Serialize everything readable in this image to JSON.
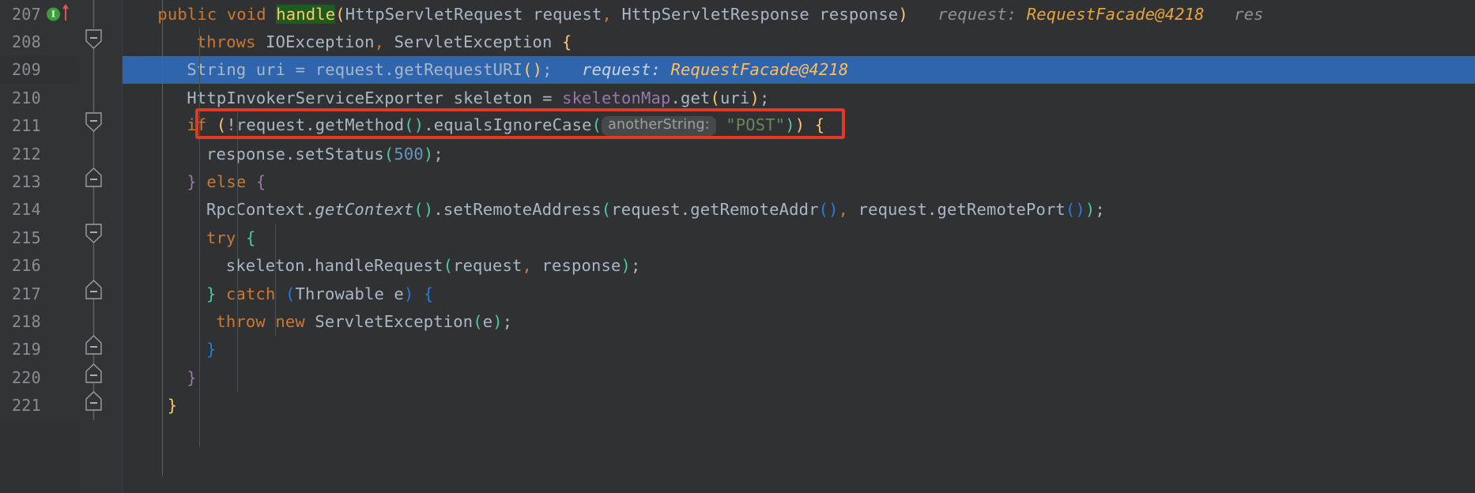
{
  "editor": {
    "language": "Java",
    "theme": "Darcula",
    "selected_line": 209,
    "annotation": {
      "type": "rectangle-highlight",
      "color": "#e03b22",
      "target_line": 211
    },
    "colors": {
      "background": "#2f3133",
      "gutter": "#313335",
      "selection": "#2f65ad",
      "keyword": "#cc7832",
      "string": "#6a8759",
      "number": "#6897bb",
      "identifier": "#a9b7c6",
      "static_field": "#9876aa",
      "method_paren": "#ffc66d",
      "inline_hint": "#8c9194",
      "hint_value": "#e8a33d",
      "annotation_red": "#e03b22",
      "usage_highlight": "#1d5c1d"
    },
    "gutter_icons": {
      "implementation_marker": {
        "line": 207,
        "glyph": "I",
        "color": "#3a9e3a",
        "arrow_color": "#e05b4b"
      }
    },
    "fold_markers": [
      {
        "line": 208,
        "direction": "start"
      },
      {
        "line": 211,
        "direction": "start"
      },
      {
        "line": 213,
        "direction": "end"
      },
      {
        "line": 215,
        "direction": "start"
      },
      {
        "line": 217,
        "direction": "end"
      },
      {
        "line": 219,
        "direction": "end"
      },
      {
        "line": 220,
        "direction": "end"
      },
      {
        "line": 221,
        "direction": "end"
      }
    ],
    "lines": [
      {
        "number": "207",
        "indent": 4,
        "tokens": [
          {
            "t": "public",
            "c": "kw"
          },
          {
            "t": " ",
            "c": "plain"
          },
          {
            "t": "void",
            "c": "kw"
          },
          {
            "t": " ",
            "c": "plain"
          },
          {
            "t": "handle",
            "c": "hl-green"
          },
          {
            "t": "(",
            "c": "paren"
          },
          {
            "t": "HttpServletRequest request",
            "c": "plain"
          },
          {
            "t": ",",
            "c": "comma"
          },
          {
            "t": " HttpServletResponse response",
            "c": "plain"
          },
          {
            "t": ")",
            "c": "paren"
          }
        ],
        "hints": [
          {
            "label": "request:",
            "value": "RequestFacade@4218"
          },
          {
            "label": "res",
            "value": ""
          }
        ]
      },
      {
        "number": "208",
        "indent": 8,
        "tokens": [
          {
            "t": "throws",
            "c": "kw"
          },
          {
            "t": " IOException",
            "c": "plain"
          },
          {
            "t": ",",
            "c": "comma"
          },
          {
            "t": " ServletException ",
            "c": "plain"
          },
          {
            "t": "{",
            "c": "paren"
          }
        ],
        "hints": []
      },
      {
        "number": "209",
        "indent": 7,
        "tokens": [
          {
            "t": "String uri = request",
            "c": "plain"
          },
          {
            "t": ".",
            "c": "punc"
          },
          {
            "t": "getRequestURI",
            "c": "plain"
          },
          {
            "t": "()",
            "c": "paren"
          },
          {
            "t": ";",
            "c": "semi"
          }
        ],
        "hints": [
          {
            "label": "request:",
            "value": "RequestFacade@4218"
          }
        ]
      },
      {
        "number": "210",
        "indent": 7,
        "tokens": [
          {
            "t": "HttpInvokerServiceExporter skeleton = ",
            "c": "plain"
          },
          {
            "t": "skeletonMap",
            "c": "static"
          },
          {
            "t": ".",
            "c": "punc"
          },
          {
            "t": "get",
            "c": "plain"
          },
          {
            "t": "(",
            "c": "paren"
          },
          {
            "t": "uri",
            "c": "plain"
          },
          {
            "t": ")",
            "c": "paren"
          },
          {
            "t": ";",
            "c": "semi"
          }
        ],
        "hints": []
      },
      {
        "number": "211",
        "indent": 7,
        "tokens": [
          {
            "t": "if",
            "c": "kw"
          },
          {
            "t": " ",
            "c": "plain"
          },
          {
            "t": "(",
            "c": "paren"
          },
          {
            "t": "!request",
            "c": "plain"
          },
          {
            "t": ".",
            "c": "punc"
          },
          {
            "t": "getMethod",
            "c": "plain"
          },
          {
            "t": "()",
            "c": "paren-g2"
          },
          {
            "t": ".",
            "c": "punc"
          },
          {
            "t": "equalsIgnoreCase",
            "c": "plain"
          },
          {
            "t": "(",
            "c": "paren-g2"
          }
        ],
        "param_chip": "anotherString:",
        "tokens_after_chip": [
          {
            "t": "\"POST\"",
            "c": "str"
          },
          {
            "t": ")",
            "c": "paren-g2"
          },
          {
            "t": ")",
            "c": "paren"
          },
          {
            "t": " ",
            "c": "plain"
          },
          {
            "t": "{",
            "c": "paren"
          }
        ],
        "hints": []
      },
      {
        "number": "212",
        "indent": 9,
        "tokens": [
          {
            "t": "response",
            "c": "plain"
          },
          {
            "t": ".",
            "c": "punc"
          },
          {
            "t": "setStatus",
            "c": "plain"
          },
          {
            "t": "(",
            "c": "paren-g2"
          },
          {
            "t": "500",
            "c": "num"
          },
          {
            "t": ")",
            "c": "paren-g2"
          },
          {
            "t": ";",
            "c": "semi"
          }
        ],
        "hints": []
      },
      {
        "number": "213",
        "indent": 7,
        "tokens": [
          {
            "t": "}",
            "c": "paren-v"
          },
          {
            "t": " ",
            "c": "plain"
          },
          {
            "t": "else",
            "c": "kw"
          },
          {
            "t": " ",
            "c": "plain"
          },
          {
            "t": "{",
            "c": "paren-v"
          }
        ],
        "hints": []
      },
      {
        "number": "214",
        "indent": 9,
        "tokens": [
          {
            "t": "RpcContext",
            "c": "plain"
          },
          {
            "t": ".",
            "c": "punc"
          },
          {
            "t": "getContext",
            "c": "staticm"
          },
          {
            "t": "()",
            "c": "paren-g2"
          },
          {
            "t": ".",
            "c": "punc"
          },
          {
            "t": "setRemoteAddress",
            "c": "plain"
          },
          {
            "t": "(",
            "c": "paren-g2"
          },
          {
            "t": "request",
            "c": "plain"
          },
          {
            "t": ".",
            "c": "punc"
          },
          {
            "t": "getRemoteAddr",
            "c": "plain"
          },
          {
            "t": "()",
            "c": "paren-b"
          },
          {
            "t": ",",
            "c": "comma"
          },
          {
            "t": " request",
            "c": "plain"
          },
          {
            "t": ".",
            "c": "punc"
          },
          {
            "t": "getRemotePort",
            "c": "plain"
          },
          {
            "t": "()",
            "c": "paren-b"
          },
          {
            "t": ")",
            "c": "paren-g2"
          },
          {
            "t": ";",
            "c": "semi"
          }
        ],
        "hints": []
      },
      {
        "number": "215",
        "indent": 9,
        "tokens": [
          {
            "t": "try",
            "c": "kw"
          },
          {
            "t": " ",
            "c": "plain"
          },
          {
            "t": "{",
            "c": "paren-g2"
          }
        ],
        "hints": []
      },
      {
        "number": "216",
        "indent": 11,
        "tokens": [
          {
            "t": "skeleton",
            "c": "plain"
          },
          {
            "t": ".",
            "c": "punc"
          },
          {
            "t": "handleRequest",
            "c": "plain"
          },
          {
            "t": "(",
            "c": "paren-g2"
          },
          {
            "t": "request",
            "c": "plain"
          },
          {
            "t": ",",
            "c": "comma"
          },
          {
            "t": " response",
            "c": "plain"
          },
          {
            "t": ")",
            "c": "paren-g2"
          },
          {
            "t": ";",
            "c": "semi"
          }
        ],
        "hints": []
      },
      {
        "number": "217",
        "indent": 9,
        "tokens": [
          {
            "t": "}",
            "c": "paren-g2"
          },
          {
            "t": " ",
            "c": "plain"
          },
          {
            "t": "catch",
            "c": "kw"
          },
          {
            "t": " ",
            "c": "plain"
          },
          {
            "t": "(",
            "c": "paren-b"
          },
          {
            "t": "Throwable e",
            "c": "plain"
          },
          {
            "t": ")",
            "c": "paren-b"
          },
          {
            "t": " ",
            "c": "plain"
          },
          {
            "t": "{",
            "c": "paren-b"
          }
        ],
        "hints": []
      },
      {
        "number": "218",
        "indent": 10,
        "tokens": [
          {
            "t": "throw",
            "c": "kw"
          },
          {
            "t": " ",
            "c": "plain"
          },
          {
            "t": "new",
            "c": "kw"
          },
          {
            "t": " ServletException",
            "c": "plain"
          },
          {
            "t": "(",
            "c": "paren-g2"
          },
          {
            "t": "e",
            "c": "plain"
          },
          {
            "t": ")",
            "c": "paren-g2"
          },
          {
            "t": ";",
            "c": "semi"
          }
        ],
        "hints": []
      },
      {
        "number": "219",
        "indent": 9,
        "tokens": [
          {
            "t": "}",
            "c": "paren-b"
          }
        ],
        "hints": []
      },
      {
        "number": "220",
        "indent": 7,
        "tokens": [
          {
            "t": "}",
            "c": "paren-v"
          }
        ],
        "hints": []
      },
      {
        "number": "221",
        "indent": 5,
        "tokens": [
          {
            "t": "}",
            "c": "paren"
          }
        ],
        "hints": []
      }
    ]
  }
}
